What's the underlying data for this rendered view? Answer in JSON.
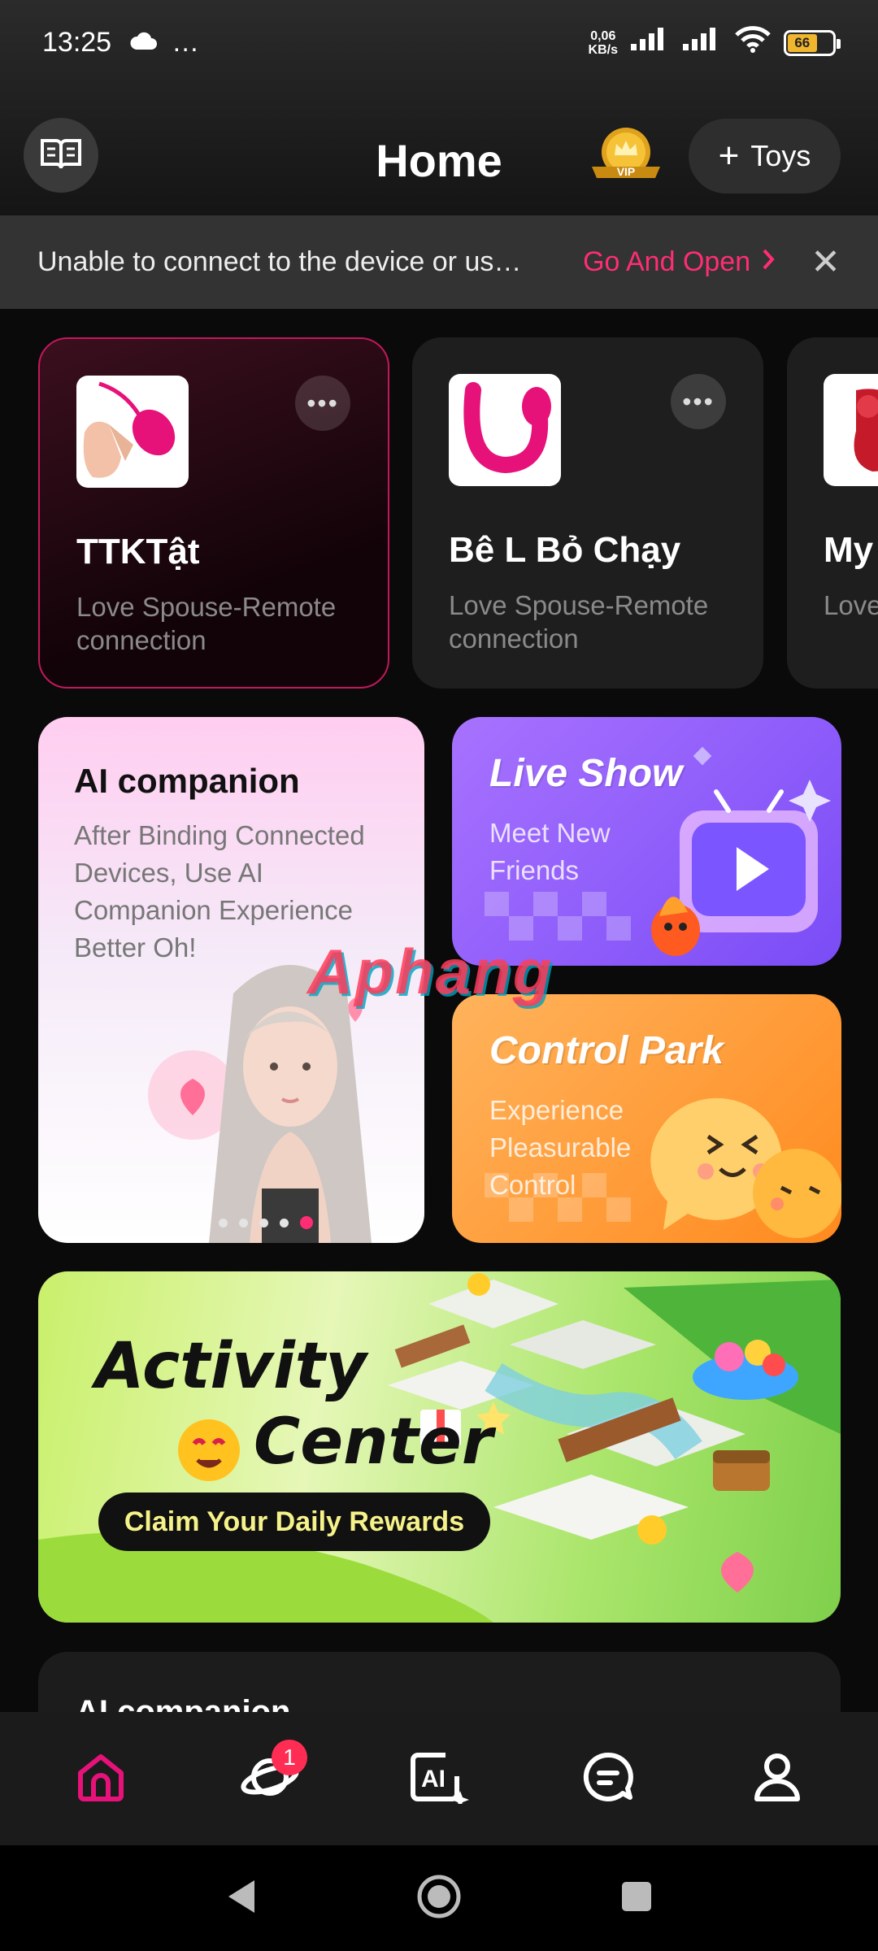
{
  "status_bar": {
    "time": "13:25",
    "more": "…",
    "net_speed_top": "0,06",
    "net_speed_bottom": "KB/s",
    "battery": "66"
  },
  "header": {
    "title": "Home",
    "vip_label": "VIP",
    "toys_label": "Toys"
  },
  "notice": {
    "message": "Unable to connect to the device or us…",
    "action": "Go And Open",
    "close": "✕"
  },
  "devices": [
    {
      "name": "TTKTật",
      "subtitle": "Love Spouse-Remote connection"
    },
    {
      "name": "Bê L Bỏ Chạy",
      "subtitle": "Love Spouse-Remote connection"
    },
    {
      "name": "My",
      "subtitle": "Love conn"
    }
  ],
  "ai_card": {
    "title": "AI companion",
    "description": "After Binding Connected Devices, Use AI Companion Experience Better Oh!",
    "slides": 5,
    "active_slide": 5
  },
  "live_show": {
    "title": "Live Show",
    "subtitle": "Meet New Friends"
  },
  "control_park": {
    "title": "Control Park",
    "subtitle": "Experience Pleasurable Control"
  },
  "activity": {
    "title_line1": "Activity",
    "title_line2": "Center",
    "button": "Claim Your Daily Rewards"
  },
  "next_section": {
    "title": "AI companion"
  },
  "tabs": [
    {
      "icon": "home-icon",
      "active": true
    },
    {
      "icon": "planet-icon",
      "badge": "1"
    },
    {
      "icon": "ai-icon"
    },
    {
      "icon": "chat-icon"
    },
    {
      "icon": "profile-icon"
    }
  ],
  "watermark": "Aphang",
  "colors": {
    "accent": "#ff2d74",
    "background": "#0a0a0a",
    "card": "#1e1e1e"
  }
}
